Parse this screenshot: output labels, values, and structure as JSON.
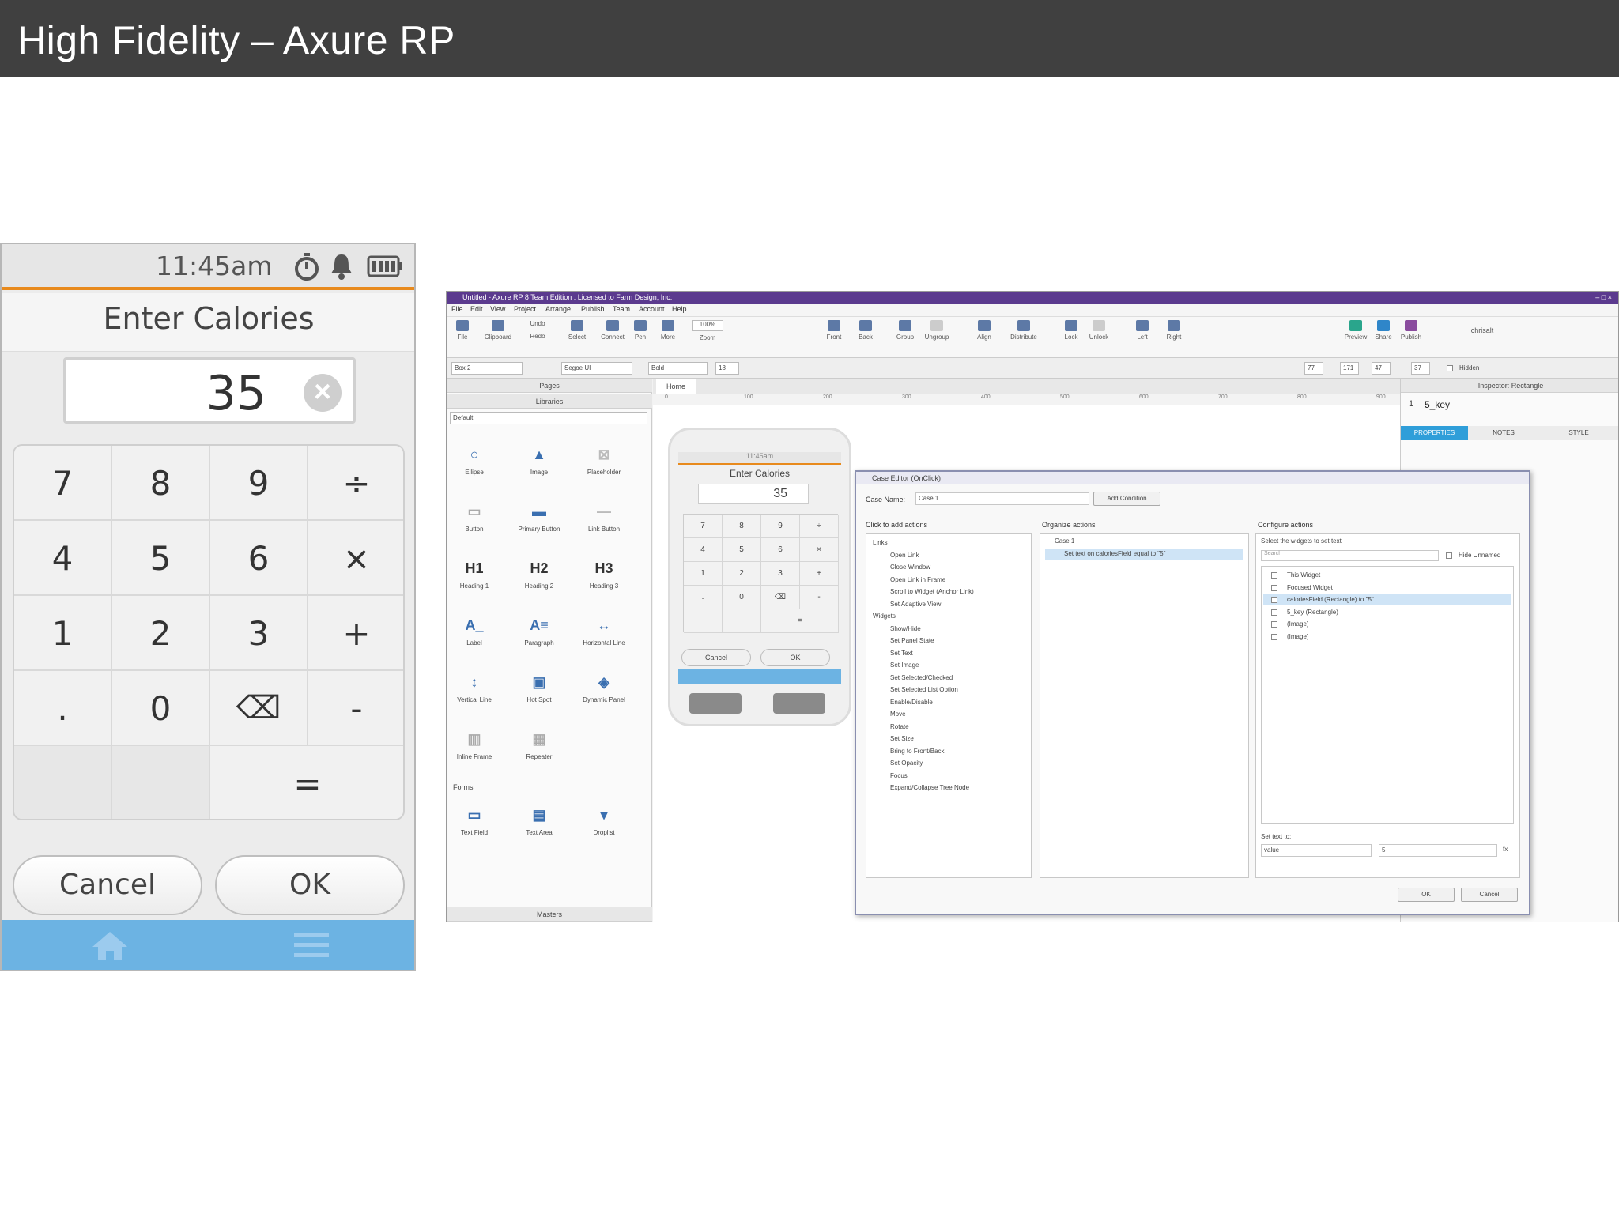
{
  "slide": {
    "title": "High Fidelity – Axure RP"
  },
  "phone": {
    "time": "11:45am",
    "title": "Enter Calories",
    "value": "35",
    "keys": [
      "7",
      "8",
      "9",
      "÷",
      "4",
      "5",
      "6",
      "×",
      "1",
      "2",
      "3",
      "+",
      ".",
      "0",
      "⌫",
      "-",
      "",
      "",
      "="
    ],
    "cancel": "Cancel",
    "ok": "OK",
    "icons": [
      "timer-icon",
      "bell-icon",
      "battery-icon",
      "home-icon",
      "menu-icon"
    ]
  },
  "axure": {
    "window_title": "Untitled - Axure RP 8 Team Edition : Licensed to Farm Design, Inc.",
    "menu": [
      "File",
      "Edit",
      "View",
      "Project",
      "Arrange",
      "Publish",
      "Team",
      "Account",
      "Help"
    ],
    "ribbon": [
      "File",
      "Clipboard",
      "Undo",
      "Redo",
      "Select",
      "Connect",
      "Pen",
      "More",
      "Zoom",
      "Front",
      "Back",
      "Group",
      "Ungroup",
      "Align",
      "Distribute",
      "Lock",
      "Unlock",
      "Left",
      "Right",
      "Preview",
      "Share",
      "Publish"
    ],
    "zoom": "100%",
    "user": "chrisalt",
    "format": {
      "widget": "Box 2",
      "font": "Segoe UI",
      "weight": "Bold",
      "size": "18",
      "x": "77",
      "y": "171",
      "w": "47",
      "h": "37",
      "hidden": "Hidden"
    },
    "left_panel": {
      "pages": "Pages",
      "libraries": "Libraries",
      "library": "Default",
      "widgets": [
        "Ellipse",
        "Image",
        "Placeholder",
        "Button",
        "Primary Button",
        "Link Button",
        "Heading 1",
        "Heading 2",
        "Heading 3",
        "Label",
        "Paragraph",
        "Horizontal Line",
        "Vertical Line",
        "Hot Spot",
        "Dynamic Panel",
        "Inline Frame",
        "Repeater"
      ],
      "headings": [
        "H1",
        "H2",
        "H3"
      ],
      "forms_label": "Forms",
      "forms": [
        "Text Field",
        "Text Area",
        "Droplist"
      ],
      "masters": "Masters"
    },
    "canvas": {
      "tab": "Home",
      "ruler": [
        "0",
        "100",
        "200",
        "300",
        "400",
        "500",
        "600",
        "700",
        "800",
        "900"
      ],
      "mini": {
        "time": "11:45am",
        "title": "Enter Calories",
        "value": "35",
        "keys": [
          "7",
          "8",
          "9",
          "÷",
          "4",
          "5",
          "6",
          "×",
          "1",
          "2",
          "3",
          "+",
          ".",
          "0",
          "⌫",
          "-",
          "",
          "",
          "="
        ],
        "cancel": "Cancel",
        "ok": "OK"
      }
    },
    "right_panel": {
      "inspector": "Inspector: Rectangle",
      "index": "1",
      "name": "5_key",
      "tabs": [
        "PROPERTIES",
        "NOTES",
        "STYLE"
      ]
    },
    "dialog": {
      "title": "Case Editor (OnClick)",
      "case_name_label": "Case Name:",
      "case_name": "Case 1",
      "add_condition": "Add Condition",
      "col1_label": "Click to add actions",
      "col2_label": "Organize actions",
      "col3_label": "Configure actions",
      "actions": [
        "Links",
        "Open Link",
        "Close Window",
        "Open Link in Frame",
        "Scroll to Widget (Anchor Link)",
        "Set Adaptive View",
        "Widgets",
        "Show/Hide",
        "Set Panel State",
        "Set Text",
        "Set Image",
        "Set Selected/Checked",
        "Set Selected List Option",
        "Enable/Disable",
        "Move",
        "Rotate",
        "Set Size",
        "Bring to Front/Back",
        "Set Opacity",
        "Focus",
        "Expand/Collapse Tree Node"
      ],
      "case": "Case 1",
      "case_action": "Set text on caloriesField equal to \"5\"",
      "configure_prompt": "Select the widgets to set text",
      "search_placeholder": "Search",
      "hide_unnamed": "Hide Unnamed",
      "targets": [
        "This Widget",
        "Focused Widget",
        "caloriesField (Rectangle) to \"5\"",
        "5_key (Rectangle)",
        "(Image)",
        "(Image)"
      ],
      "set_text_to": "Set text to:",
      "value_type": "value",
      "value": "5",
      "fx": "fx",
      "ok": "OK",
      "cancel": "Cancel"
    }
  }
}
